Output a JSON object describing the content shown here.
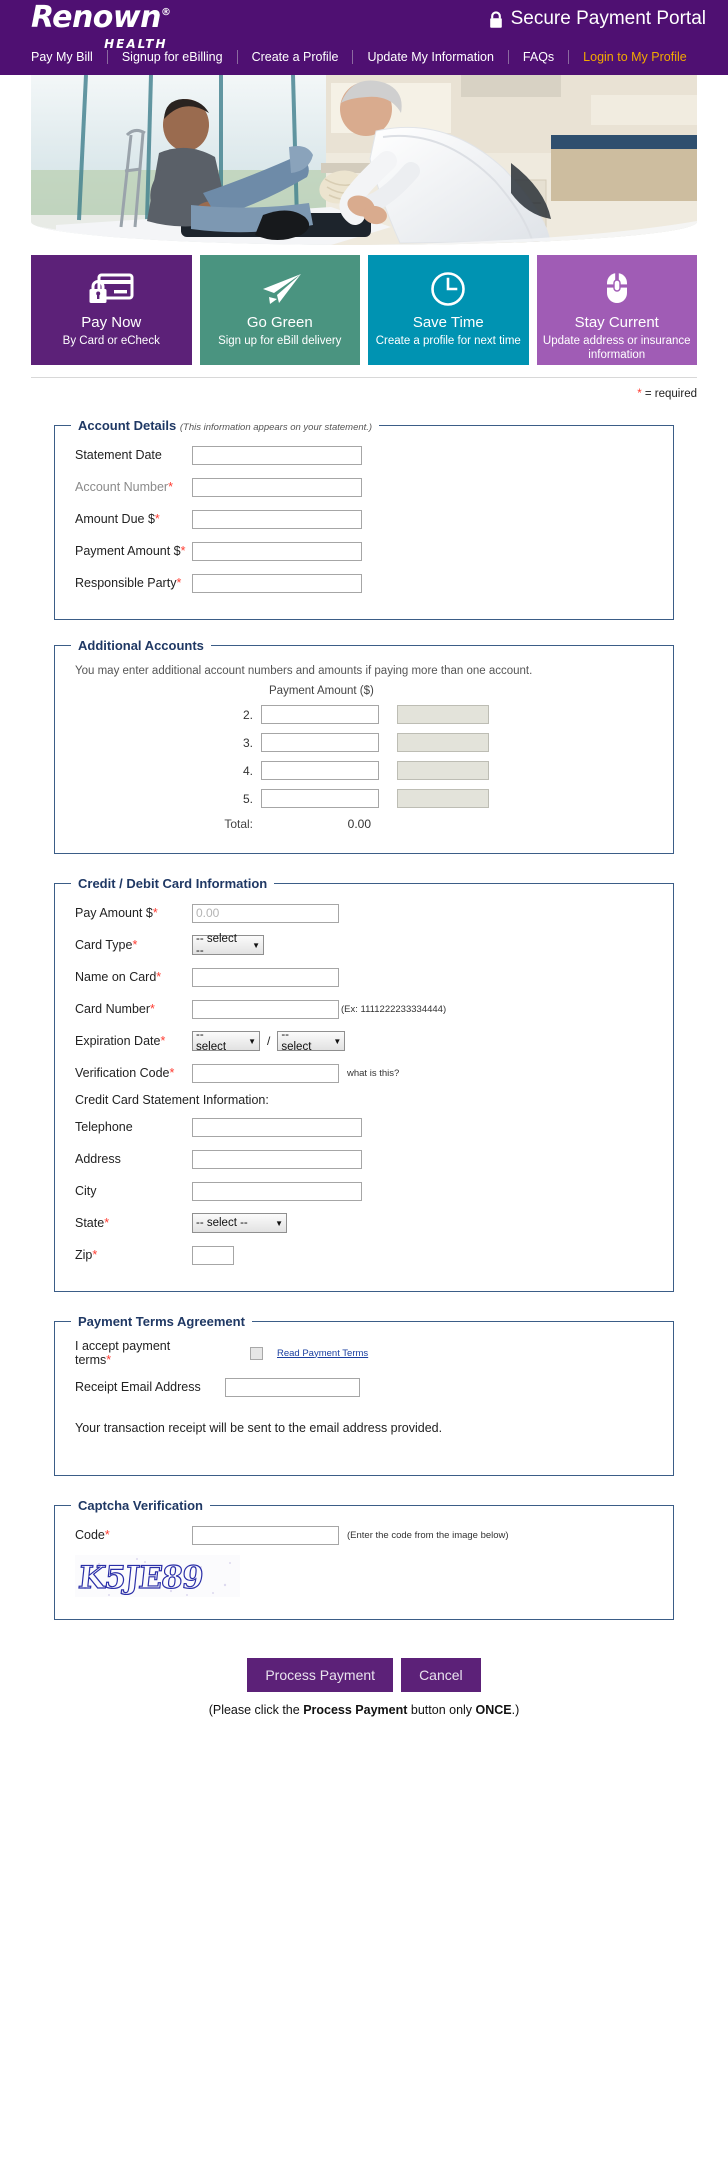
{
  "brand": {
    "logo_name": "Renown",
    "logo_reg": "®",
    "logo_sub": "HEALTH",
    "header_color": "#4F1072",
    "accent_color": "#F2A900",
    "required_color": "#ff3b30"
  },
  "header": {
    "secure_title": "Secure Payment Portal",
    "lock_icon": "lock-icon"
  },
  "nav": {
    "items": [
      {
        "label": "Pay My Bill",
        "highlight": false
      },
      {
        "label": "Signup for eBilling",
        "highlight": false
      },
      {
        "label": "Create a Profile",
        "highlight": false
      },
      {
        "label": "Update My Information",
        "highlight": false
      },
      {
        "label": "FAQs",
        "highlight": false
      },
      {
        "label": "Login to My Profile",
        "highlight": true
      }
    ]
  },
  "hero": {
    "alt": "Doctor wrapping a bandage on a seated patient's ankle in a clinic exam room"
  },
  "tiles": [
    {
      "title": "Pay Now",
      "sub": "By Card or eCheck",
      "color": "#5C2178",
      "icon": "credit-card-lock-icon"
    },
    {
      "title": "Go Green",
      "sub": "Sign up for eBill delivery",
      "color": "#4A9480",
      "icon": "paper-plane-icon"
    },
    {
      "title": "Save Time",
      "sub": "Create a profile for next time",
      "color": "#0093B2",
      "icon": "clock-icon"
    },
    {
      "title": "Stay Current",
      "sub": "Update address or insurance information",
      "color": "#A05CB5",
      "icon": "mouse-icon"
    }
  ],
  "required_note": {
    "star": "*",
    "text": " = required"
  },
  "account_details": {
    "legend": "Account Details",
    "legend_note": "(This information appears on your statement.)",
    "fields": [
      {
        "label": "Statement Date",
        "required": false,
        "muted": false,
        "value": ""
      },
      {
        "label": "Account Number",
        "required": true,
        "muted": true,
        "value": ""
      },
      {
        "label": "Amount Due $",
        "required": true,
        "muted": false,
        "value": ""
      },
      {
        "label": "Payment Amount $",
        "required": true,
        "muted": false,
        "value": ""
      },
      {
        "label": "Responsible Party",
        "required": true,
        "muted": false,
        "value": ""
      }
    ]
  },
  "additional_accounts": {
    "legend": "Additional Accounts",
    "description": "You may enter additional account numbers and amounts if paying more than one account.",
    "amount_header": "Payment Amount ($)",
    "rows": [
      {
        "num": "2.",
        "account": "",
        "amount": ""
      },
      {
        "num": "3.",
        "account": "",
        "amount": ""
      },
      {
        "num": "4.",
        "account": "",
        "amount": ""
      },
      {
        "num": "5.",
        "account": "",
        "amount": ""
      }
    ],
    "total_label": "Total:",
    "total_value": "0.00"
  },
  "card_info": {
    "legend": "Credit / Debit Card Information",
    "pay_amount_label": "Pay Amount $",
    "pay_amount_placeholder": "0.00",
    "pay_amount_value": "",
    "card_type_label": "Card Type",
    "card_type_value": "-- select --",
    "name_on_card_label": "Name on Card",
    "name_on_card_value": "",
    "card_number_label": "Card Number",
    "card_number_value": "",
    "card_number_hint": "(Ex: 1111222233334444)",
    "expiration_label": "Expiration Date",
    "exp_month_value": "-- select",
    "exp_separator": "/",
    "exp_year_value": "-- select",
    "verification_label": "Verification Code",
    "verification_value": "",
    "verification_hint": "what is this?",
    "statement_subhead": "Credit Card Statement Information:",
    "telephone_label": "Telephone",
    "telephone_value": "",
    "address_label": "Address",
    "address_value": "",
    "city_label": "City",
    "city_value": "",
    "state_label": "State",
    "state_value": "-- select --",
    "zip_label": "Zip",
    "zip_value": ""
  },
  "payment_terms": {
    "legend": "Payment Terms Agreement",
    "accept_label": "I accept payment terms",
    "accept_checked": false,
    "read_terms_link": "Read Payment Terms",
    "email_label": "Receipt Email Address",
    "email_value": "",
    "note": "Your transaction receipt will be sent to the email address provided."
  },
  "captcha": {
    "legend": "Captcha Verification",
    "code_label": "Code",
    "code_value": "",
    "hint": "(Enter the code from the image below)",
    "image_text": "K5JE89"
  },
  "actions": {
    "process_label": "Process Payment",
    "cancel_label": "Cancel",
    "footnote_pre": "(Please click the ",
    "footnote_bold1": "Process Payment",
    "footnote_mid": " button only ",
    "footnote_bold2": "ONCE",
    "footnote_post": ".)"
  }
}
